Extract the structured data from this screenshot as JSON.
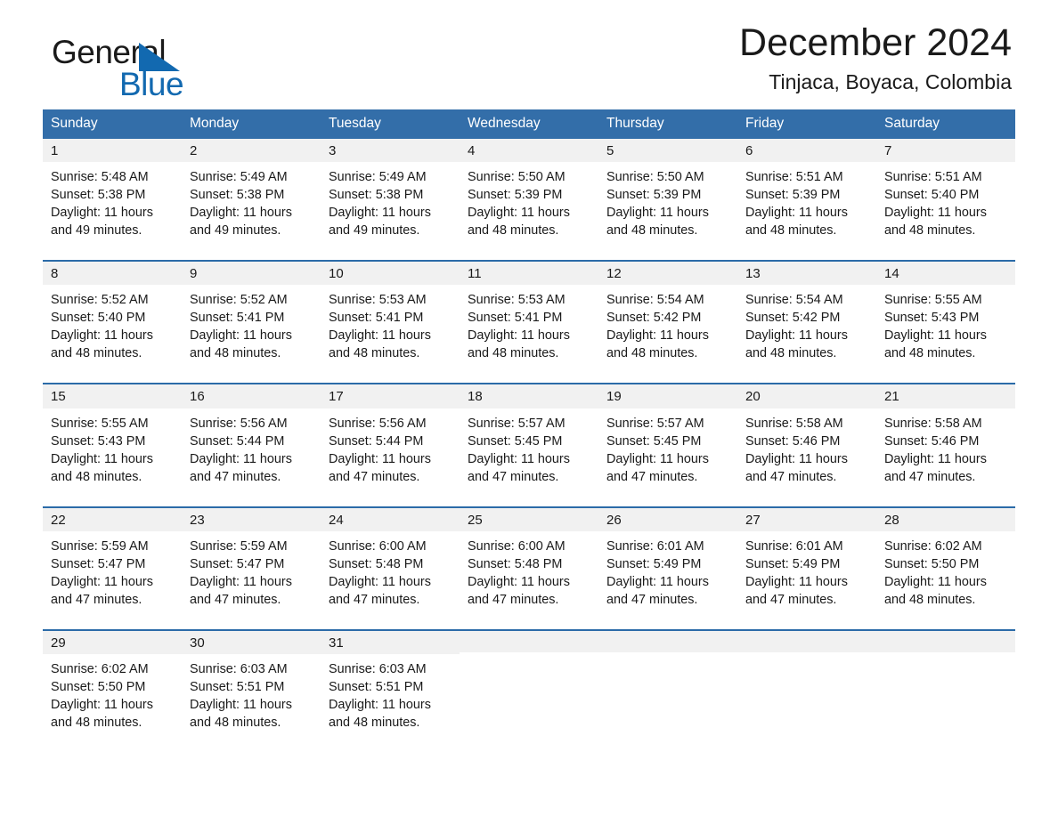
{
  "brand": {
    "word_one": "General",
    "word_two": "Blue",
    "triangle_color": "#1269b0",
    "text_color": "#1a1a1a"
  },
  "header": {
    "title": "December 2024",
    "subtitle": "Tinjaca, Boyaca, Colombia"
  },
  "calendar": {
    "header_bg": "#336ea9",
    "row_divider_color": "#2b6ba8",
    "day_band_bg": "#f1f1f1",
    "weekdays": [
      "Sunday",
      "Monday",
      "Tuesday",
      "Wednesday",
      "Thursday",
      "Friday",
      "Saturday"
    ],
    "weeks": [
      [
        {
          "day": "1",
          "sunrise": "Sunrise: 5:48 AM",
          "sunset": "Sunset: 5:38 PM",
          "daylight_line1": "Daylight: 11 hours",
          "daylight_line2": "and 49 minutes."
        },
        {
          "day": "2",
          "sunrise": "Sunrise: 5:49 AM",
          "sunset": "Sunset: 5:38 PM",
          "daylight_line1": "Daylight: 11 hours",
          "daylight_line2": "and 49 minutes."
        },
        {
          "day": "3",
          "sunrise": "Sunrise: 5:49 AM",
          "sunset": "Sunset: 5:38 PM",
          "daylight_line1": "Daylight: 11 hours",
          "daylight_line2": "and 49 minutes."
        },
        {
          "day": "4",
          "sunrise": "Sunrise: 5:50 AM",
          "sunset": "Sunset: 5:39 PM",
          "daylight_line1": "Daylight: 11 hours",
          "daylight_line2": "and 48 minutes."
        },
        {
          "day": "5",
          "sunrise": "Sunrise: 5:50 AM",
          "sunset": "Sunset: 5:39 PM",
          "daylight_line1": "Daylight: 11 hours",
          "daylight_line2": "and 48 minutes."
        },
        {
          "day": "6",
          "sunrise": "Sunrise: 5:51 AM",
          "sunset": "Sunset: 5:39 PM",
          "daylight_line1": "Daylight: 11 hours",
          "daylight_line2": "and 48 minutes."
        },
        {
          "day": "7",
          "sunrise": "Sunrise: 5:51 AM",
          "sunset": "Sunset: 5:40 PM",
          "daylight_line1": "Daylight: 11 hours",
          "daylight_line2": "and 48 minutes."
        }
      ],
      [
        {
          "day": "8",
          "sunrise": "Sunrise: 5:52 AM",
          "sunset": "Sunset: 5:40 PM",
          "daylight_line1": "Daylight: 11 hours",
          "daylight_line2": "and 48 minutes."
        },
        {
          "day": "9",
          "sunrise": "Sunrise: 5:52 AM",
          "sunset": "Sunset: 5:41 PM",
          "daylight_line1": "Daylight: 11 hours",
          "daylight_line2": "and 48 minutes."
        },
        {
          "day": "10",
          "sunrise": "Sunrise: 5:53 AM",
          "sunset": "Sunset: 5:41 PM",
          "daylight_line1": "Daylight: 11 hours",
          "daylight_line2": "and 48 minutes."
        },
        {
          "day": "11",
          "sunrise": "Sunrise: 5:53 AM",
          "sunset": "Sunset: 5:41 PM",
          "daylight_line1": "Daylight: 11 hours",
          "daylight_line2": "and 48 minutes."
        },
        {
          "day": "12",
          "sunrise": "Sunrise: 5:54 AM",
          "sunset": "Sunset: 5:42 PM",
          "daylight_line1": "Daylight: 11 hours",
          "daylight_line2": "and 48 minutes."
        },
        {
          "day": "13",
          "sunrise": "Sunrise: 5:54 AM",
          "sunset": "Sunset: 5:42 PM",
          "daylight_line1": "Daylight: 11 hours",
          "daylight_line2": "and 48 minutes."
        },
        {
          "day": "14",
          "sunrise": "Sunrise: 5:55 AM",
          "sunset": "Sunset: 5:43 PM",
          "daylight_line1": "Daylight: 11 hours",
          "daylight_line2": "and 48 minutes."
        }
      ],
      [
        {
          "day": "15",
          "sunrise": "Sunrise: 5:55 AM",
          "sunset": "Sunset: 5:43 PM",
          "daylight_line1": "Daylight: 11 hours",
          "daylight_line2": "and 48 minutes."
        },
        {
          "day": "16",
          "sunrise": "Sunrise: 5:56 AM",
          "sunset": "Sunset: 5:44 PM",
          "daylight_line1": "Daylight: 11 hours",
          "daylight_line2": "and 47 minutes."
        },
        {
          "day": "17",
          "sunrise": "Sunrise: 5:56 AM",
          "sunset": "Sunset: 5:44 PM",
          "daylight_line1": "Daylight: 11 hours",
          "daylight_line2": "and 47 minutes."
        },
        {
          "day": "18",
          "sunrise": "Sunrise: 5:57 AM",
          "sunset": "Sunset: 5:45 PM",
          "daylight_line1": "Daylight: 11 hours",
          "daylight_line2": "and 47 minutes."
        },
        {
          "day": "19",
          "sunrise": "Sunrise: 5:57 AM",
          "sunset": "Sunset: 5:45 PM",
          "daylight_line1": "Daylight: 11 hours",
          "daylight_line2": "and 47 minutes."
        },
        {
          "day": "20",
          "sunrise": "Sunrise: 5:58 AM",
          "sunset": "Sunset: 5:46 PM",
          "daylight_line1": "Daylight: 11 hours",
          "daylight_line2": "and 47 minutes."
        },
        {
          "day": "21",
          "sunrise": "Sunrise: 5:58 AM",
          "sunset": "Sunset: 5:46 PM",
          "daylight_line1": "Daylight: 11 hours",
          "daylight_line2": "and 47 minutes."
        }
      ],
      [
        {
          "day": "22",
          "sunrise": "Sunrise: 5:59 AM",
          "sunset": "Sunset: 5:47 PM",
          "daylight_line1": "Daylight: 11 hours",
          "daylight_line2": "and 47 minutes."
        },
        {
          "day": "23",
          "sunrise": "Sunrise: 5:59 AM",
          "sunset": "Sunset: 5:47 PM",
          "daylight_line1": "Daylight: 11 hours",
          "daylight_line2": "and 47 minutes."
        },
        {
          "day": "24",
          "sunrise": "Sunrise: 6:00 AM",
          "sunset": "Sunset: 5:48 PM",
          "daylight_line1": "Daylight: 11 hours",
          "daylight_line2": "and 47 minutes."
        },
        {
          "day": "25",
          "sunrise": "Sunrise: 6:00 AM",
          "sunset": "Sunset: 5:48 PM",
          "daylight_line1": "Daylight: 11 hours",
          "daylight_line2": "and 47 minutes."
        },
        {
          "day": "26",
          "sunrise": "Sunrise: 6:01 AM",
          "sunset": "Sunset: 5:49 PM",
          "daylight_line1": "Daylight: 11 hours",
          "daylight_line2": "and 47 minutes."
        },
        {
          "day": "27",
          "sunrise": "Sunrise: 6:01 AM",
          "sunset": "Sunset: 5:49 PM",
          "daylight_line1": "Daylight: 11 hours",
          "daylight_line2": "and 47 minutes."
        },
        {
          "day": "28",
          "sunrise": "Sunrise: 6:02 AM",
          "sunset": "Sunset: 5:50 PM",
          "daylight_line1": "Daylight: 11 hours",
          "daylight_line2": "and 48 minutes."
        }
      ],
      [
        {
          "day": "29",
          "sunrise": "Sunrise: 6:02 AM",
          "sunset": "Sunset: 5:50 PM",
          "daylight_line1": "Daylight: 11 hours",
          "daylight_line2": "and 48 minutes."
        },
        {
          "day": "30",
          "sunrise": "Sunrise: 6:03 AM",
          "sunset": "Sunset: 5:51 PM",
          "daylight_line1": "Daylight: 11 hours",
          "daylight_line2": "and 48 minutes."
        },
        {
          "day": "31",
          "sunrise": "Sunrise: 6:03 AM",
          "sunset": "Sunset: 5:51 PM",
          "daylight_line1": "Daylight: 11 hours",
          "daylight_line2": "and 48 minutes."
        },
        {
          "day": "",
          "sunrise": "",
          "sunset": "",
          "daylight_line1": "",
          "daylight_line2": ""
        },
        {
          "day": "",
          "sunrise": "",
          "sunset": "",
          "daylight_line1": "",
          "daylight_line2": ""
        },
        {
          "day": "",
          "sunrise": "",
          "sunset": "",
          "daylight_line1": "",
          "daylight_line2": ""
        },
        {
          "day": "",
          "sunrise": "",
          "sunset": "",
          "daylight_line1": "",
          "daylight_line2": ""
        }
      ]
    ]
  }
}
